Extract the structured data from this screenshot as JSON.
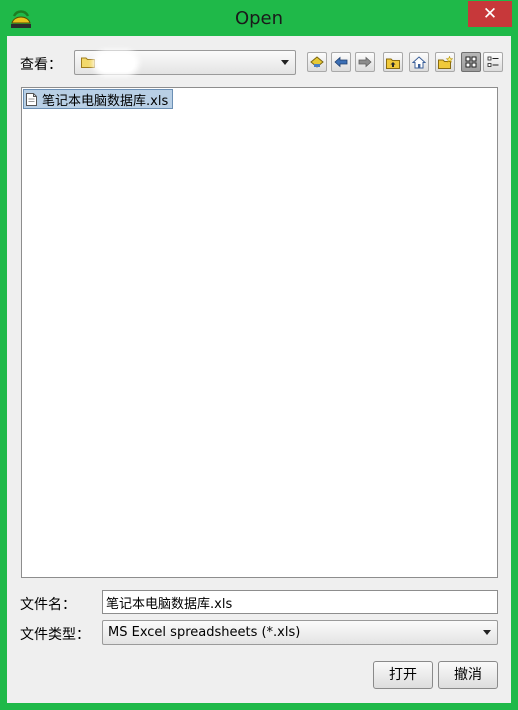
{
  "window": {
    "title": "Open",
    "close_symbol": "✕"
  },
  "look_in": {
    "label": "查看：",
    "current_folder": ""
  },
  "toolbar": {
    "icons": [
      "desktop-icon",
      "back-icon",
      "forward-icon",
      "up-folder-icon",
      "home-icon",
      "new-folder-icon",
      "list-view-icon",
      "details-view-icon"
    ]
  },
  "files": [
    {
      "name": "笔记本电脑数据库.xls",
      "selected": true
    }
  ],
  "file_name": {
    "label": "文件名：",
    "value": "笔记本电脑数据库.xls"
  },
  "file_type": {
    "label": "文件类型：",
    "selected": "MS Excel spreadsheets (*.xls)"
  },
  "buttons": {
    "open": "打开",
    "cancel": "撤消"
  },
  "colors": {
    "frame": "#1fb949",
    "close": "#c7383a",
    "selection": "#b8cfe5"
  }
}
